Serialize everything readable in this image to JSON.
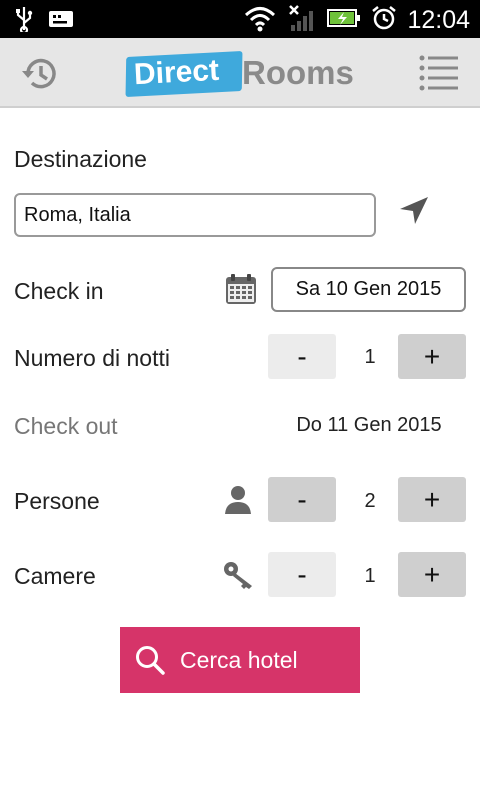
{
  "status_bar": {
    "time": "12:04",
    "icons": [
      "usb-icon",
      "keyboard-icon",
      "wifi-icon",
      "signal-icon",
      "battery-icon",
      "alarm-icon"
    ]
  },
  "app_bar": {
    "logo_part1": "Direct",
    "logo_part2": "Rooms",
    "left_icon": "history-icon",
    "right_icon": "list-menu-icon"
  },
  "form": {
    "destination_label": "Destinazione",
    "destination_value": "Roma, Italia",
    "checkin_label": "Check in",
    "checkin_value": "Sa 10 Gen 2015",
    "nights_label": "Numero di notti",
    "nights_value": "1",
    "checkout_label": "Check out",
    "checkout_value": "Do 11 Gen 2015",
    "persons_label": "Persone",
    "persons_value": "2",
    "rooms_label": "Camere",
    "rooms_value": "1",
    "minus_label": "-",
    "plus_label": "+"
  },
  "search_button": {
    "label": "Cerca hotel"
  },
  "colors": {
    "accent": "#d63469",
    "logo_blue": "#3fa9dc",
    "appbar_bg": "#e6e6e6"
  }
}
